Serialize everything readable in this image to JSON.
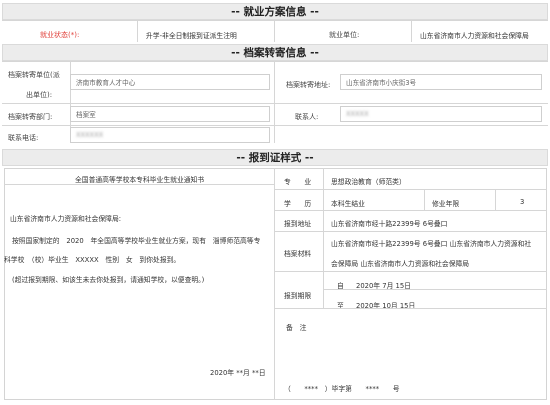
{
  "sections": {
    "employment": "-- 就业方案信息 --",
    "archive": "-- 档案转寄信息 --",
    "report": "-- 报到证样式 --"
  },
  "employment": {
    "status_label": "就业状态(*):",
    "status_value": "升学-非全日制报到证派生注明",
    "unit_label": "就业单位:",
    "unit_value": "山东省济南市人力资源和社会保障局"
  },
  "archive": {
    "unit_label_1": "档案转寄单位(派",
    "unit_label_2": "出单位):",
    "unit_value": "济南市教育人才中心",
    "address_label": "档案转寄地址:",
    "address_value": "山东省济南市小庆街3号",
    "dept_label": "档案转寄部门:",
    "dept_value": "档案室",
    "contact_label": "联系人:",
    "contact_value": "XXXXX",
    "phone_label": "联系电话:",
    "phone_value": "XXXXXX"
  },
  "letter": {
    "title": "全国普通高等学校本专科毕业生就业通知书",
    "recipient": "山东省济南市人力资源和社会保障局:",
    "body_1": "按照国家制定的　2020　年全国高等学校毕业生就业方案，现有　淄博师范高等专",
    "body_2": "科学校　（校）毕业生　XXXXX　性别　女　到你处报到。",
    "body_3": "(超过报到期限、如该生未去你处报到，请通知学校，以便查明。)",
    "date": "2020年 **月 **日"
  },
  "info": {
    "major_label": "专　　业",
    "major_value": "思想政治教育（师范类）",
    "edu_label": "学　　历",
    "edu_value": "本科生结业",
    "years_label": "修业年限",
    "years_value": "3",
    "report_addr_label": "报到地址",
    "report_addr_value": "山东省济南市经十路22399号 6号叠口",
    "archive_mat_label": "档案材料",
    "archive_mat_value_1": "山东省济南市经十路22399号 6号叠口 山东省济南市人力资源和社",
    "archive_mat_value_2": "会保障局 山东省济南市人力资源和社会保障局",
    "period_label": "报到期限",
    "from_label": "自",
    "from_value": "2020年  7月  15日",
    "to_label": "至",
    "to_value": "2020年 10月  15日",
    "remark_label": "备　注",
    "serial": "（　　****　）毕字第　　****　　号"
  }
}
